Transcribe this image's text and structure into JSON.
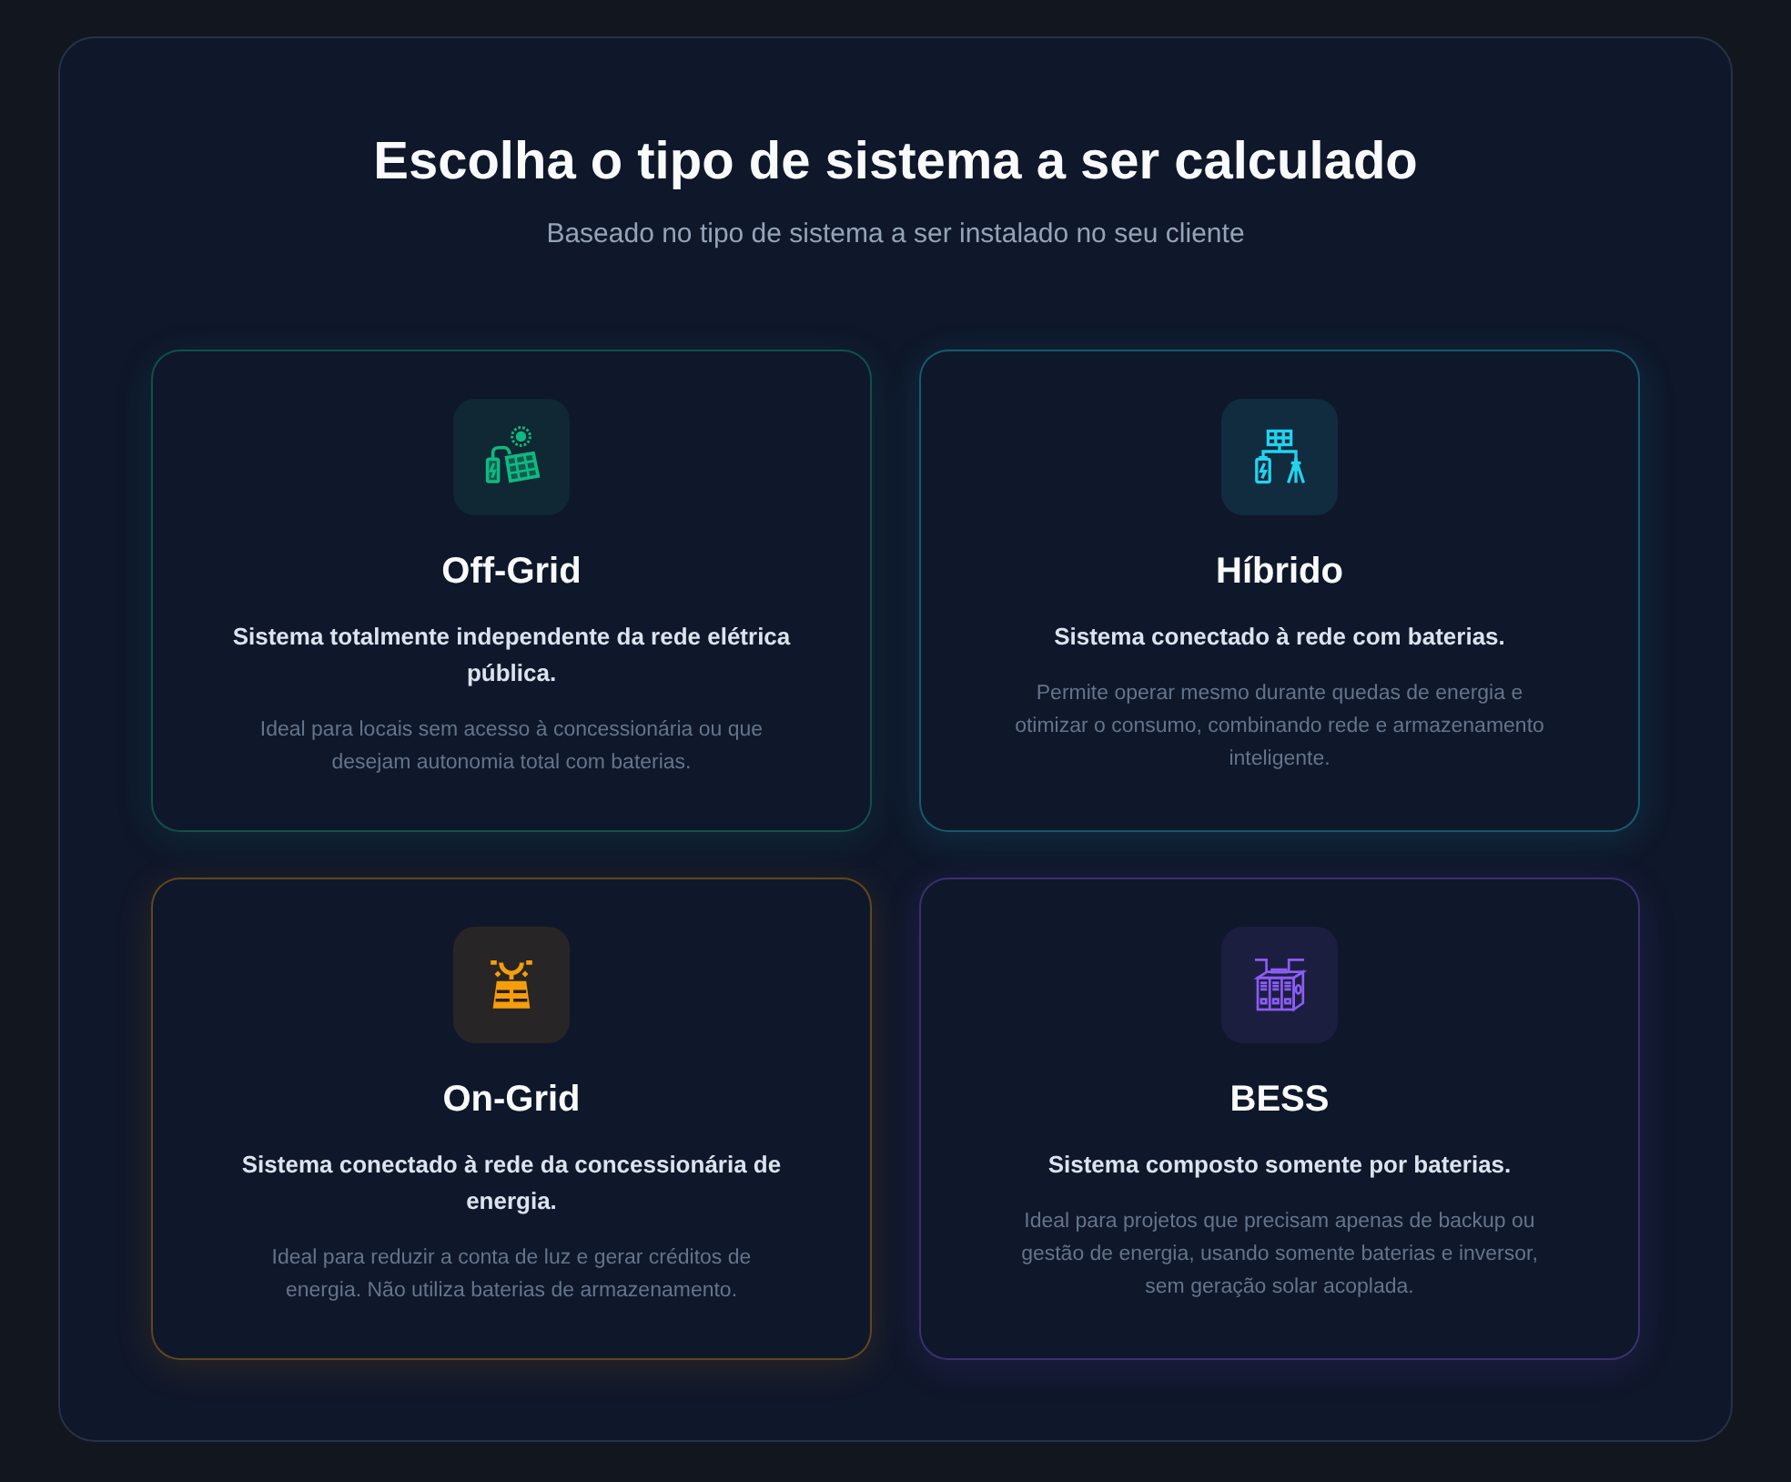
{
  "header": {
    "title": "Escolha o tipo de sistema a ser calculado",
    "subtitle": "Baseado no tipo de sistema a ser instalado no seu cliente"
  },
  "cards": [
    {
      "kind": "off_grid",
      "color": "#10b981",
      "title": "Off-Grid",
      "summary": "Sistema totalmente independente da rede elétrica pública.",
      "detail": "Ideal para locais sem acesso à concessionária ou que desejam autonomia total com baterias."
    },
    {
      "kind": "hybrid",
      "color": "#22d3ee",
      "title": "Híbrido",
      "summary": "Sistema conectado à rede com baterias.",
      "detail": "Permite operar mesmo durante quedas de energia e otimizar o consumo, combinando rede e armazenamento inteligente."
    },
    {
      "kind": "on_grid",
      "color": "#f59e0b",
      "title": "On-Grid",
      "summary": "Sistema conectado à rede da concessionária de energia.",
      "detail": "Ideal para reduzir a conta de luz e gerar créditos de energia. Não utiliza baterias de armazenamento."
    },
    {
      "kind": "bess",
      "color": "#8b5cf6",
      "title": "BESS",
      "summary": "Sistema composto somente por baterias.",
      "detail": "Ideal para projetos que precisam apenas de backup ou gestão de energia, usando somente baterias e inversor, sem geração solar acoplada."
    }
  ]
}
